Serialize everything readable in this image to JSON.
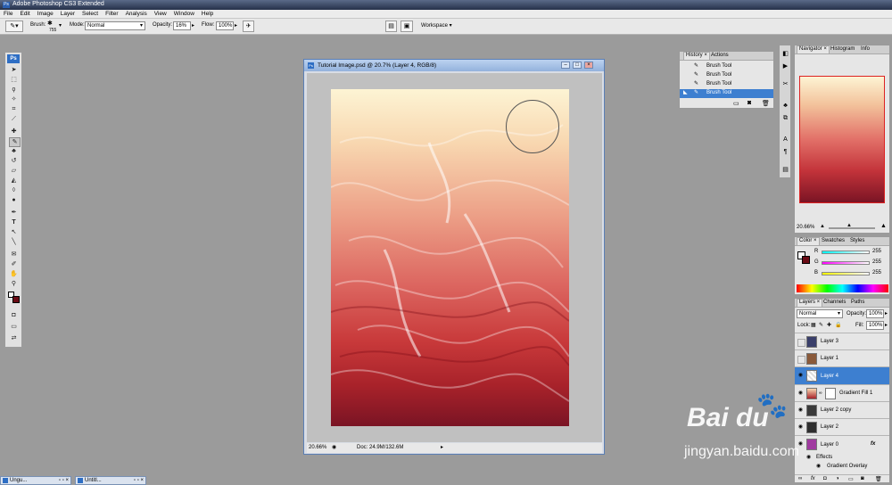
{
  "app": {
    "title": "Adobe Photoshop CS3 Extended",
    "logo": "Ps"
  },
  "menu": [
    "File",
    "Edit",
    "Image",
    "Layer",
    "Select",
    "Filter",
    "Analysis",
    "View",
    "Window",
    "Help"
  ],
  "options": {
    "brush_label": "Brush:",
    "brush_size": "755",
    "mode_label": "Mode:",
    "mode_value": "Normal",
    "opacity_label": "Opacity:",
    "opacity_value": "16%",
    "flow_label": "Flow:",
    "flow_value": "100%",
    "workspace_label": "Workspace"
  },
  "document": {
    "title": "Tutorial Image.psd @ 20.7% (Layer 4, RGB/8)",
    "zoom": "20.66%",
    "doc_info": "Doc: 24.9M/132.6M"
  },
  "history": {
    "tabs": [
      "History",
      "Actions"
    ],
    "items": [
      "Brush Tool",
      "Brush Tool",
      "Brush Tool",
      "Brush Tool"
    ],
    "selected_index": 3
  },
  "navigator": {
    "tabs": [
      "Navigator",
      "Histogram",
      "Info"
    ],
    "zoom": "20.66%"
  },
  "color_panel": {
    "tabs": [
      "Color",
      "Swatches",
      "Styles"
    ],
    "channels": [
      {
        "label": "R",
        "value": "255"
      },
      {
        "label": "G",
        "value": "255"
      },
      {
        "label": "B",
        "value": "255"
      }
    ]
  },
  "layers_panel": {
    "tabs": [
      "Layers",
      "Channels",
      "Paths"
    ],
    "blend_mode": "Normal",
    "opacity_label": "Opacity:",
    "opacity_value": "100%",
    "lock_label": "Lock:",
    "fill_label": "Fill:",
    "fill_value": "100%",
    "layers": [
      {
        "name": "Layer 3",
        "visible": false,
        "selected": false
      },
      {
        "name": "Layer 1",
        "visible": false,
        "selected": false
      },
      {
        "name": "Layer 4",
        "visible": true,
        "selected": true
      },
      {
        "name": "Gradient Fill 1",
        "visible": true,
        "selected": false
      },
      {
        "name": "Layer 2 copy",
        "visible": true,
        "selected": false
      },
      {
        "name": "Layer 2",
        "visible": true,
        "selected": false
      },
      {
        "name": "Layer 0",
        "visible": true,
        "selected": false
      }
    ],
    "effects_label": "Effects",
    "effect_item": "Gradient Overlay",
    "fx_label": "fx"
  },
  "taskbar": {
    "items": [
      "Ungu...",
      "Untitl..."
    ]
  },
  "watermark": {
    "brand": "Bai du",
    "url": "jingyan.baidu.com"
  },
  "colors": {
    "accent": "#3d7fd0",
    "title_bar": "#26314a",
    "canvas_top": "#fdf4d4",
    "canvas_bottom": "#7a1424"
  }
}
